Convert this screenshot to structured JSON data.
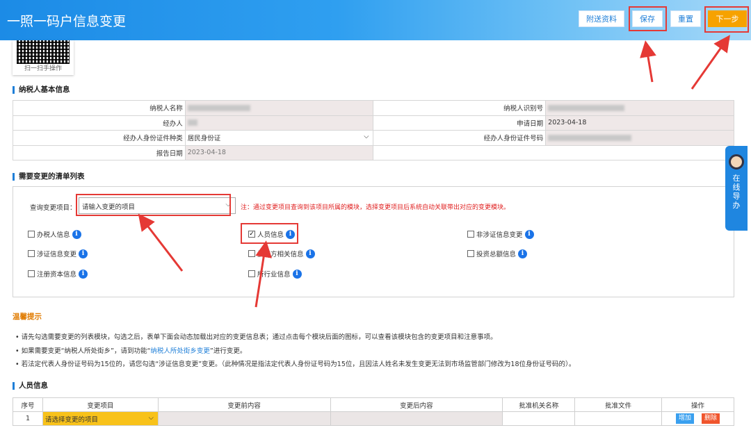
{
  "header": {
    "title": "一照一码户信息变更",
    "buttons": {
      "attach": "附送资料",
      "save": "保存",
      "reset": "重置",
      "next": "下一步"
    }
  },
  "qr": {
    "caption": "扫一扫手操作"
  },
  "taxpayer_section": {
    "title": "纳税人基本信息",
    "rows": [
      {
        "l1": "纳税人名称",
        "v1": "",
        "l2": "纳税人识别号",
        "v2": ""
      },
      {
        "l1": "经办人",
        "v1": "",
        "l2": "申请日期",
        "v2": "2023-04-18"
      },
      {
        "l1": "经办人身份证件种类",
        "v1": "居民身份证",
        "l2": "经办人身份证件号码",
        "v2": ""
      },
      {
        "l1": "报告日期",
        "v1": "2023-04-18",
        "l2": "",
        "v2": ""
      }
    ]
  },
  "change_section": {
    "title": "需要变更的清单列表",
    "query_label": "查询变更项目：",
    "query_placeholder": "请输入变更的项目",
    "note": "注：通过变更项目查询到该项目所属的模块，选择变更项目后系统自动关联带出对应的变更模块。",
    "items": [
      {
        "label": "办税人信息",
        "checked": false
      },
      {
        "label": "人员信息",
        "checked": true
      },
      {
        "label": "非涉证信息变更",
        "checked": false
      },
      {
        "label": "涉证信息变更",
        "checked": false
      },
      {
        "label": "投资方相关信息",
        "checked": false
      },
      {
        "label": "投资总额信息",
        "checked": false
      },
      {
        "label": "注册资本信息",
        "checked": false
      },
      {
        "label": "所行业信息",
        "checked": false
      }
    ]
  },
  "tips": {
    "title": "温馨提示",
    "t1": "请先勾选需要变更的列表模块，勾选之后，表单下面会动态加载出对应的变更信息表；通过点击每个模块后面的图标，可以查看该模块包含的变更项目和注意事项。",
    "t2_pre": "如果需要变更“纳税人所处街乡”，请到功能“",
    "t2_link": "纳税人所处街乡变更",
    "t2_post": "”进行变更。",
    "t3": "若法定代表人身份证号码为15位的，请您勾选“涉证信息变更”变更。（此种情况是指法定代表人身份证号码为15位，且因法人姓名未发生变更无法到市场监管部门修改为18位身份证号码的）。"
  },
  "person_section": {
    "title": "人员信息",
    "headers": [
      "序号",
      "变更项目",
      "变更前内容",
      "变更后内容",
      "批准机关名称",
      "批准文件",
      "操作"
    ],
    "row": {
      "index": "1",
      "item": "请选择变更的项目",
      "add": "增加",
      "del": "删除"
    }
  },
  "side_guide": {
    "text": "在线导办"
  },
  "colors": {
    "header": "#1c8be6",
    "next_button": "#f6a200",
    "highlight": "#e53935",
    "select_yellow": "#f8c21a"
  }
}
